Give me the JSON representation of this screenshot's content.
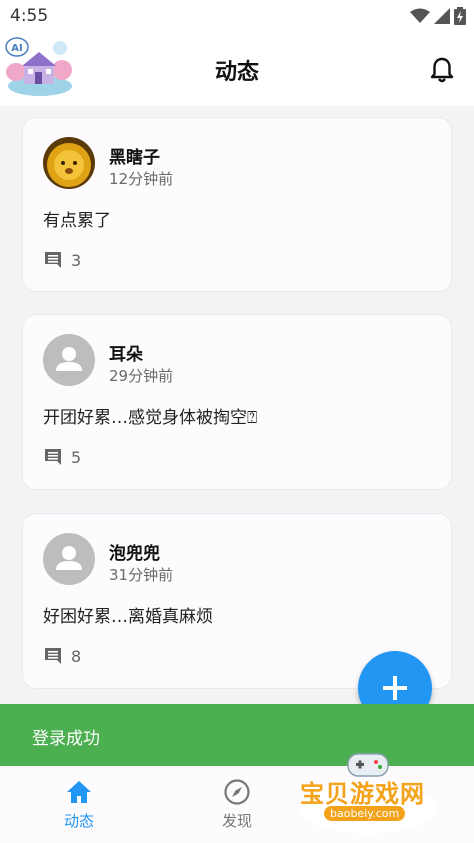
{
  "status_bar": {
    "time": "4:55"
  },
  "header": {
    "title": "动态"
  },
  "posts": [
    {
      "username": "黑瞎子",
      "time": "12分钟前",
      "content": "有点累了",
      "comments": "3",
      "avatar": "lion-photo"
    },
    {
      "username": "耳朵",
      "time": "29分钟前",
      "content": "开团好累…感觉身体被掏空⍰",
      "comments": "5",
      "avatar": "default-person"
    },
    {
      "username": "泡兜兜",
      "time": "31分钟前",
      "content": "好困好累…离婚真麻烦",
      "comments": "8",
      "avatar": "default-person"
    }
  ],
  "fab": {
    "icon": "plus-icon"
  },
  "toast": {
    "text": "登录成功"
  },
  "bottom_nav": {
    "items": [
      {
        "label": "动态",
        "icon": "home-icon",
        "active": true
      },
      {
        "label": "发现",
        "icon": "compass-icon",
        "active": false
      }
    ],
    "active_color": "#2196f3",
    "inactive_color": "#777777"
  },
  "watermark": {
    "text": "宝贝游戏网",
    "url": "baobeiy.com"
  },
  "colors": {
    "accent": "#2196f3",
    "toast": "#4caf50"
  }
}
